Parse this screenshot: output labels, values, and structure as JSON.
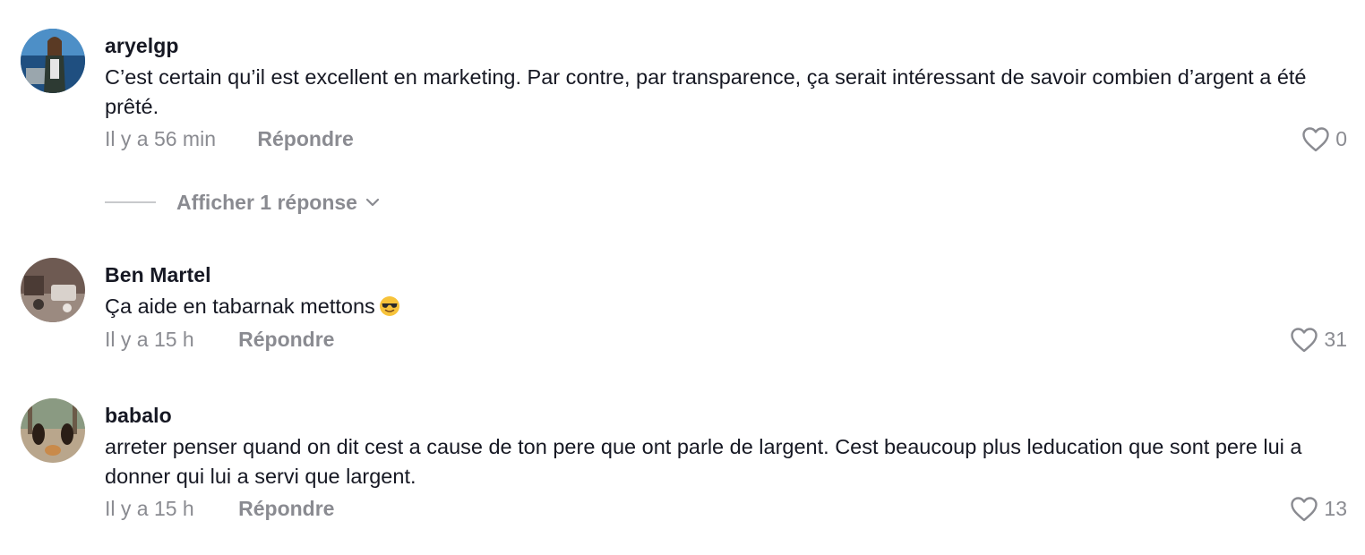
{
  "comments": [
    {
      "username": "aryelgp",
      "text": "C’est certain qu’il est excellent en marketing. Par contre, par transparence, ça serait intéressant de savoir combien d’argent a été prêté.",
      "time": "Il y a 56 min",
      "reply_label": "Répondre",
      "likes": "0",
      "view_replies": "Afficher 1 réponse"
    },
    {
      "username": "Ben Martel",
      "text": "Ça aide en tabarnak mettons",
      "emoji": "smiling-face-with-sunglasses",
      "time": "Il y a 15 h",
      "reply_label": "Répondre",
      "likes": "31"
    },
    {
      "username": "babalo",
      "text": "arreter penser quand on dit cest a cause de ton pere que ont parle de largent. Cest beaucoup plus leducation que sont pere lui a donner qui lui a servi que largent.",
      "time": "Il y a 15 h",
      "reply_label": "Répondre",
      "likes": "13"
    }
  ],
  "colors": {
    "text": "#161823",
    "secondary": "#8a8b91"
  }
}
